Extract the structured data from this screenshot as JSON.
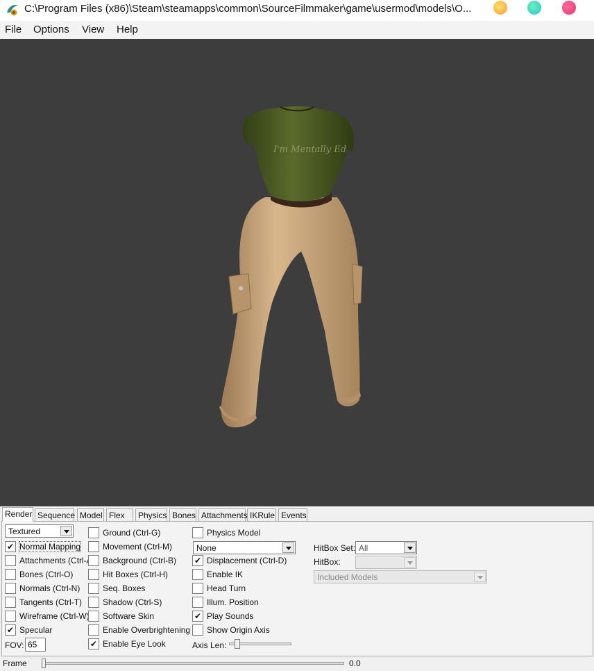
{
  "window": {
    "title": "C:\\Program Files (x86)\\Steam\\steamapps\\common\\SourceFilmmaker\\game\\usermod\\models\\O..."
  },
  "menu": [
    "File",
    "Options",
    "View",
    "Help"
  ],
  "tabs": [
    "Render",
    "Sequence",
    "Model",
    "Flex",
    "Physics",
    "Bones",
    "Attachments",
    "IKRule",
    "Events"
  ],
  "active_tab": "Render",
  "render": {
    "render_mode": "Textured",
    "col1": [
      {
        "label": "Normal Mapping",
        "checked": true
      },
      {
        "label": "Attachments (Ctrl-A)",
        "checked": false
      },
      {
        "label": "Bones (Ctrl-O)",
        "checked": false
      },
      {
        "label": "Normals (Ctrl-N)",
        "checked": false
      },
      {
        "label": "Tangents (Ctrl-T)",
        "checked": false
      },
      {
        "label": "Wireframe (Ctrl-W)",
        "checked": false
      },
      {
        "label": "Specular",
        "checked": true
      }
    ],
    "col2": [
      {
        "label": "Ground (Ctrl-G)",
        "checked": false
      },
      {
        "label": "Movement (Ctrl-M)",
        "checked": false
      },
      {
        "label": "Background (Ctrl-B)",
        "checked": false
      },
      {
        "label": "Hit Boxes (Ctrl-H)",
        "checked": false
      },
      {
        "label": "Seq. Boxes",
        "checked": false
      },
      {
        "label": "Shadow (Ctrl-S)",
        "checked": false
      },
      {
        "label": "Software Skin",
        "checked": false
      },
      {
        "label": "Enable Overbrightening",
        "checked": false
      },
      {
        "label": "Enable Eye Look",
        "checked": true
      }
    ],
    "physics_model": {
      "label": "Physics Model",
      "checked": false
    },
    "physics_combo": "None",
    "col3": [
      {
        "label": "Displacement (Ctrl-D)",
        "checked": true
      },
      {
        "label": "Enable IK",
        "checked": false
      },
      {
        "label": "Head Turn",
        "checked": false
      },
      {
        "label": "Illum. Position",
        "checked": false
      },
      {
        "label": "Play Sounds",
        "checked": true
      },
      {
        "label": "Show Origin Axis",
        "checked": false
      }
    ],
    "fov_label": "FOV:",
    "fov_value": "65",
    "axis_len_label": "Axis Len:",
    "axis_len_level": 0.1,
    "hitbox_set_label": "HitBox Set:",
    "hitbox_set_value": "All",
    "hitbox_label": "HitBox:",
    "hitbox_value": "",
    "included_models": "Included Models"
  },
  "frame": {
    "label": "Frame",
    "value": "0.0",
    "level": 0.0
  },
  "model": {
    "shirt_text": "I'm Mentally Ed",
    "shirt_color": "#4a5a22",
    "pants_color": "#c9a57c",
    "background_color": "#3d3d3d"
  }
}
